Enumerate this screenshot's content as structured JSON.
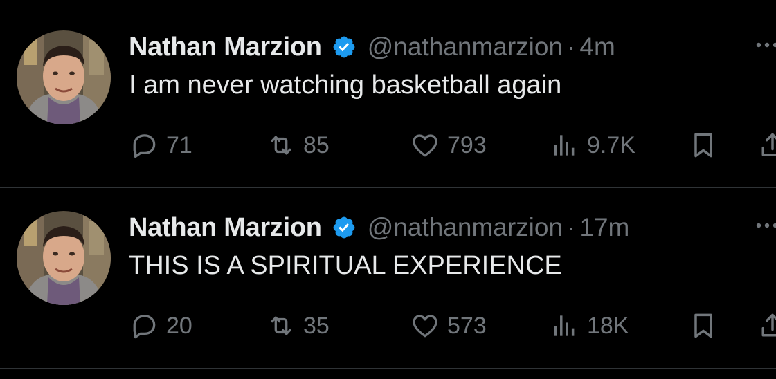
{
  "colors": {
    "background": "#000000",
    "primary_text": "#e7e9ea",
    "secondary_text": "#71767b",
    "divider": "#2f3336",
    "verified_badge": "#1d9bf0"
  },
  "icons": {
    "verified": "verified-badge-icon",
    "more": "more-dots-icon",
    "reply": "reply-icon",
    "retweet": "retweet-icon",
    "like": "heart-icon",
    "views": "views-chart-icon",
    "bookmark": "bookmark-icon",
    "share": "share-icon"
  },
  "tweets": [
    {
      "author_name": "Nathan Marzion",
      "handle": "@nathanmarzion",
      "separator": "·",
      "time": "4m",
      "text": "I am never watching basketball again",
      "replies": "71",
      "retweets": "85",
      "likes": "793",
      "views": "9.7K"
    },
    {
      "author_name": "Nathan Marzion",
      "handle": "@nathanmarzion",
      "separator": "·",
      "time": "17m",
      "text": "THIS IS A SPIRITUAL EXPERIENCE",
      "replies": "20",
      "retweets": "35",
      "likes": "573",
      "views": "18K"
    }
  ]
}
